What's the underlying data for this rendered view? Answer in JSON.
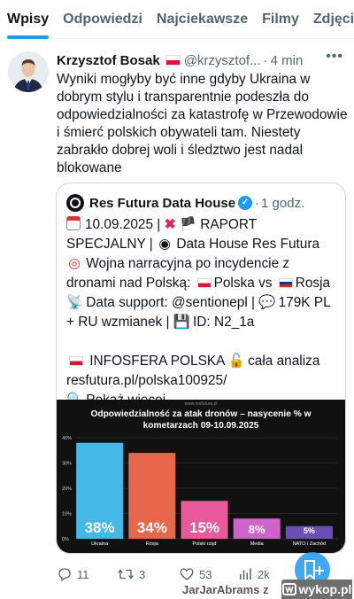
{
  "tabs": [
    "Wpisy",
    "Odpowiedzi",
    "Najciekawsze",
    "Filmy",
    "Zdjęcia"
  ],
  "post": {
    "author": "Krzysztof Bosak",
    "handle": "@krzysztof...",
    "sep": "·",
    "time": "4 min",
    "text": "Wyniki mogłyby być inne gdyby Ukraina w dobrym stylu i transparentnie podeszła do odpowiedzialności za katastrofę w Przewodowie i śmierć polskich obywateli tam. Niestety zabrakło dobrej woli i śledztwo jest nadal blokowane"
  },
  "quote": {
    "name": "Res Futura Data House",
    "sep": "·",
    "time": "1 godz.",
    "line1a": "10.09.2025 |",
    "line1b": "RAPORT",
    "line2a": "SPECJALNY |",
    "line2b": "Data House Res Futura",
    "line3": "Wojna narracyjna po incydencie z",
    "line4a": "dronami nad Polską:",
    "line4b": "Polska vs",
    "line4c": "Rosja",
    "line5a": "Data support: @sentionepl |",
    "line5b": "179K PL",
    "line6a": "+ RU wzmianek |",
    "line6b": "ID: N2_1a",
    "line7a": "INFOSFERA POLSKA",
    "line7b": "cała analiza",
    "line8": "resfutura.pl/polska100925/",
    "showmore": "Pokaż więcej"
  },
  "chart_data": {
    "type": "bar",
    "title": "Odpowiedzialność za atak dronów – nasycenie % w kometarzach 09-10.09.2025",
    "source_url": "www.resfutura.pl",
    "categories": [
      "Ukraina",
      "Rosja",
      "Polski rząd",
      "Media",
      "NATO i Zachód"
    ],
    "values": [
      38,
      34,
      15,
      8,
      5
    ],
    "value_labels": [
      "38%",
      "34%",
      "15%",
      "8%",
      "5%"
    ],
    "colors": [
      "#44b9e6",
      "#e8674a",
      "#e85a9c",
      "#d063c9",
      "#6b4fb5"
    ],
    "ylim": [
      0,
      40
    ],
    "yticks": [
      0,
      10,
      20,
      30,
      40
    ],
    "ytick_labels": [
      "0%",
      "10%",
      "20%",
      "30%",
      "40%"
    ],
    "grid": true
  },
  "actions": {
    "replies": "11",
    "reposts": "3",
    "likes": "53",
    "views": "2k"
  },
  "footer": {
    "user": "JarJarAbrams",
    "z": "z",
    "site": "wykop.pl"
  }
}
